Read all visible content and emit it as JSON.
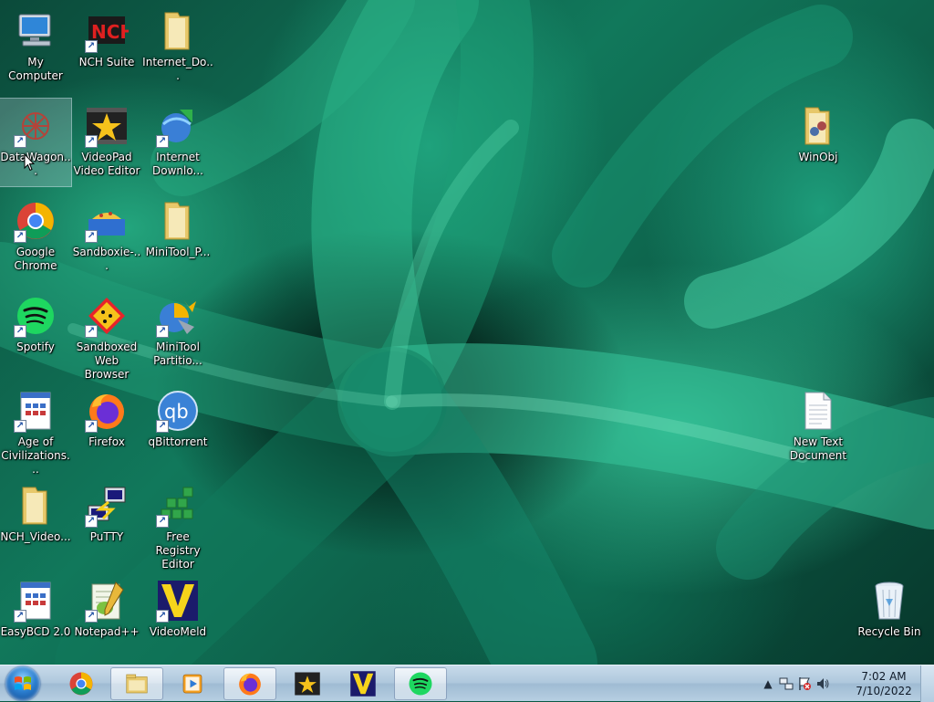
{
  "desktop": {
    "icons": [
      {
        "id": "my-computer",
        "label": "My Computer",
        "icon": "computer-icon",
        "shortcut": false
      },
      {
        "id": "nch-suite",
        "label": "NCH Suite",
        "icon": "nch-suite-icon",
        "shortcut": true
      },
      {
        "id": "internet-do",
        "label": "Internet_Do...",
        "icon": "folder-icon",
        "shortcut": false
      },
      {
        "id": "datawagon",
        "label": "DataWagon...",
        "icon": "datawagon-icon",
        "shortcut": true,
        "selected": true
      },
      {
        "id": "videopad",
        "label": "VideoPad Video Editor",
        "icon": "videopad-icon",
        "shortcut": true
      },
      {
        "id": "internet-download",
        "label": "Internet Downlo...",
        "icon": "internet-download-manager-icon",
        "shortcut": true
      },
      {
        "id": "google-chrome",
        "label": "Google Chrome",
        "icon": "chrome-icon",
        "shortcut": true
      },
      {
        "id": "sandboxie",
        "label": "Sandboxie-...",
        "icon": "sandboxie-icon",
        "shortcut": true
      },
      {
        "id": "minitool-p",
        "label": "MiniTool_P...",
        "icon": "folder-icon",
        "shortcut": false
      },
      {
        "id": "spotify",
        "label": "Spotify",
        "icon": "spotify-icon",
        "shortcut": true
      },
      {
        "id": "sandboxed-browser",
        "label": "Sandboxed Web Browser",
        "icon": "sandboxed-browser-icon",
        "shortcut": true
      },
      {
        "id": "minitool-partition",
        "label": "MiniTool Partitio...",
        "icon": "minitool-partition-icon",
        "shortcut": true
      },
      {
        "id": "age-of-civ",
        "label": "Age of Civilizations...",
        "icon": "application-icon",
        "shortcut": true
      },
      {
        "id": "firefox",
        "label": "Firefox",
        "icon": "firefox-icon",
        "shortcut": true
      },
      {
        "id": "qbittorrent",
        "label": "qBittorrent",
        "icon": "qbittorrent-icon",
        "shortcut": true
      },
      {
        "id": "nch-video",
        "label": "NCH_Video...",
        "icon": "folder-icon",
        "shortcut": false
      },
      {
        "id": "putty",
        "label": "PuTTY",
        "icon": "putty-icon",
        "shortcut": true
      },
      {
        "id": "free-registry",
        "label": "Free Registry Editor",
        "icon": "registry-editor-icon",
        "shortcut": true
      },
      {
        "id": "easybcd",
        "label": "EasyBCD 2.0",
        "icon": "application-icon",
        "shortcut": true
      },
      {
        "id": "notepadpp",
        "label": "Notepad++",
        "icon": "notepadpp-icon",
        "shortcut": true
      },
      {
        "id": "videomeld",
        "label": "VideoMeld",
        "icon": "videomeld-icon",
        "shortcut": true
      },
      {
        "id": "winobj",
        "label": "WinObj",
        "icon": "winobj-folder-icon",
        "shortcut": false
      },
      {
        "id": "new-text-doc",
        "label": "New Text Document",
        "icon": "text-document-icon",
        "shortcut": false
      },
      {
        "id": "recycle-bin",
        "label": "Recycle Bin",
        "icon": "recycle-bin-icon",
        "shortcut": false
      }
    ]
  },
  "taskbar": {
    "start_icon": "windows-start-icon",
    "pinned": [
      {
        "id": "chrome",
        "icon": "chrome-icon"
      },
      {
        "id": "explorer",
        "icon": "file-explorer-icon"
      },
      {
        "id": "media-player",
        "icon": "media-player-icon"
      },
      {
        "id": "firefox",
        "icon": "firefox-icon"
      },
      {
        "id": "videopad",
        "icon": "videopad-icon"
      },
      {
        "id": "videomeld",
        "icon": "videomeld-icon"
      },
      {
        "id": "spotify",
        "icon": "spotify-icon"
      }
    ],
    "tray": {
      "show_hidden": "▲",
      "time": "7:02 AM",
      "date": "7/10/2022"
    }
  }
}
